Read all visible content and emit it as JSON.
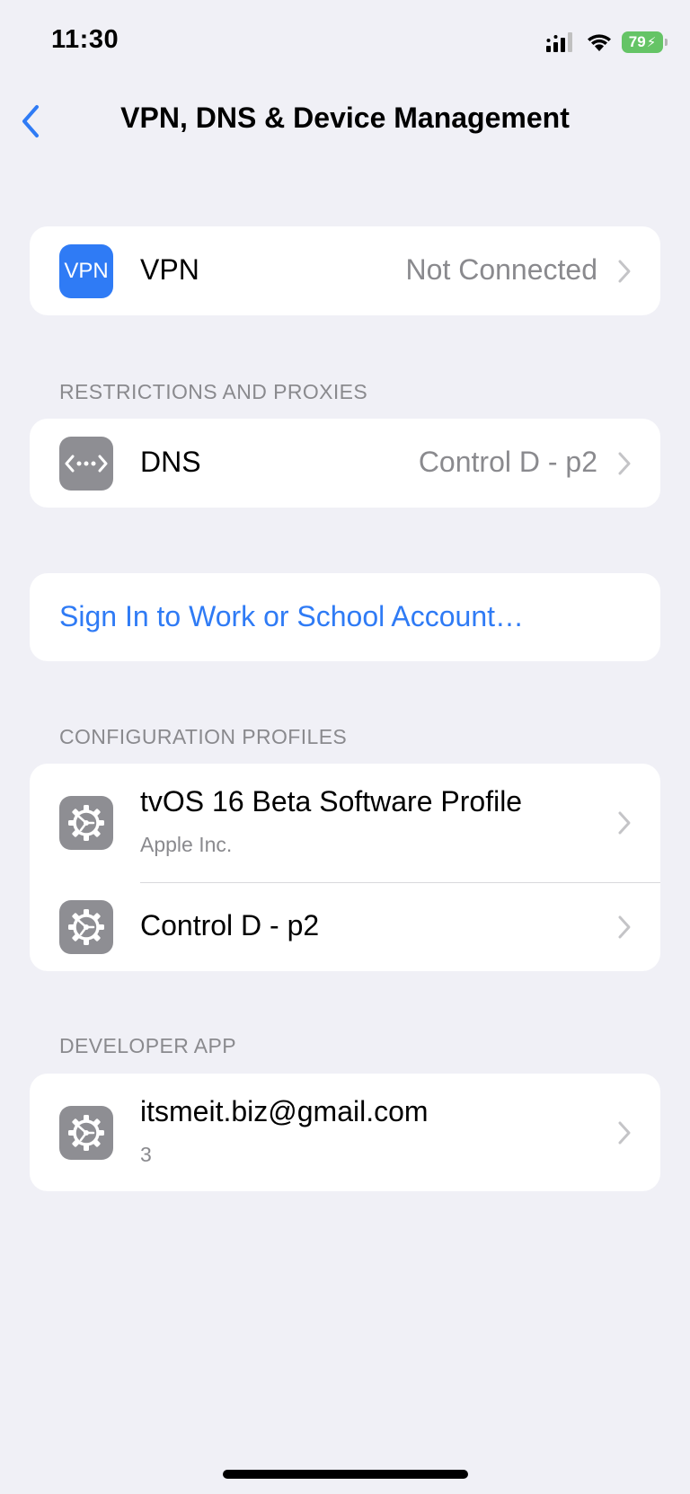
{
  "status_bar": {
    "time": "11:30",
    "battery_percent": "79"
  },
  "nav": {
    "title": "VPN, DNS & Device Management",
    "back_icon": "chevron-left-icon"
  },
  "vpn_group": {
    "icon_text": "VPN",
    "title": "VPN",
    "value": "Not Connected"
  },
  "restrictions": {
    "header": "RESTRICTIONS AND PROXIES",
    "dns_title": "DNS",
    "dns_value": "Control D - p2"
  },
  "account": {
    "sign_in_label": "Sign In to Work or School Account…"
  },
  "profiles": {
    "header": "CONFIGURATION PROFILES",
    "items": [
      {
        "title": "tvOS 16 Beta Software Profile",
        "subtitle": "Apple Inc."
      },
      {
        "title": "Control D - p2"
      }
    ]
  },
  "developer": {
    "header": "DEVELOPER APP",
    "items": [
      {
        "title": "itsmeit.biz@gmail.com",
        "subtitle": "3"
      }
    ]
  },
  "colors": {
    "accent": "#2f7bf5",
    "background": "#f0f0f6",
    "secondary_text": "#8a8a8e",
    "battery": "#65c466"
  }
}
